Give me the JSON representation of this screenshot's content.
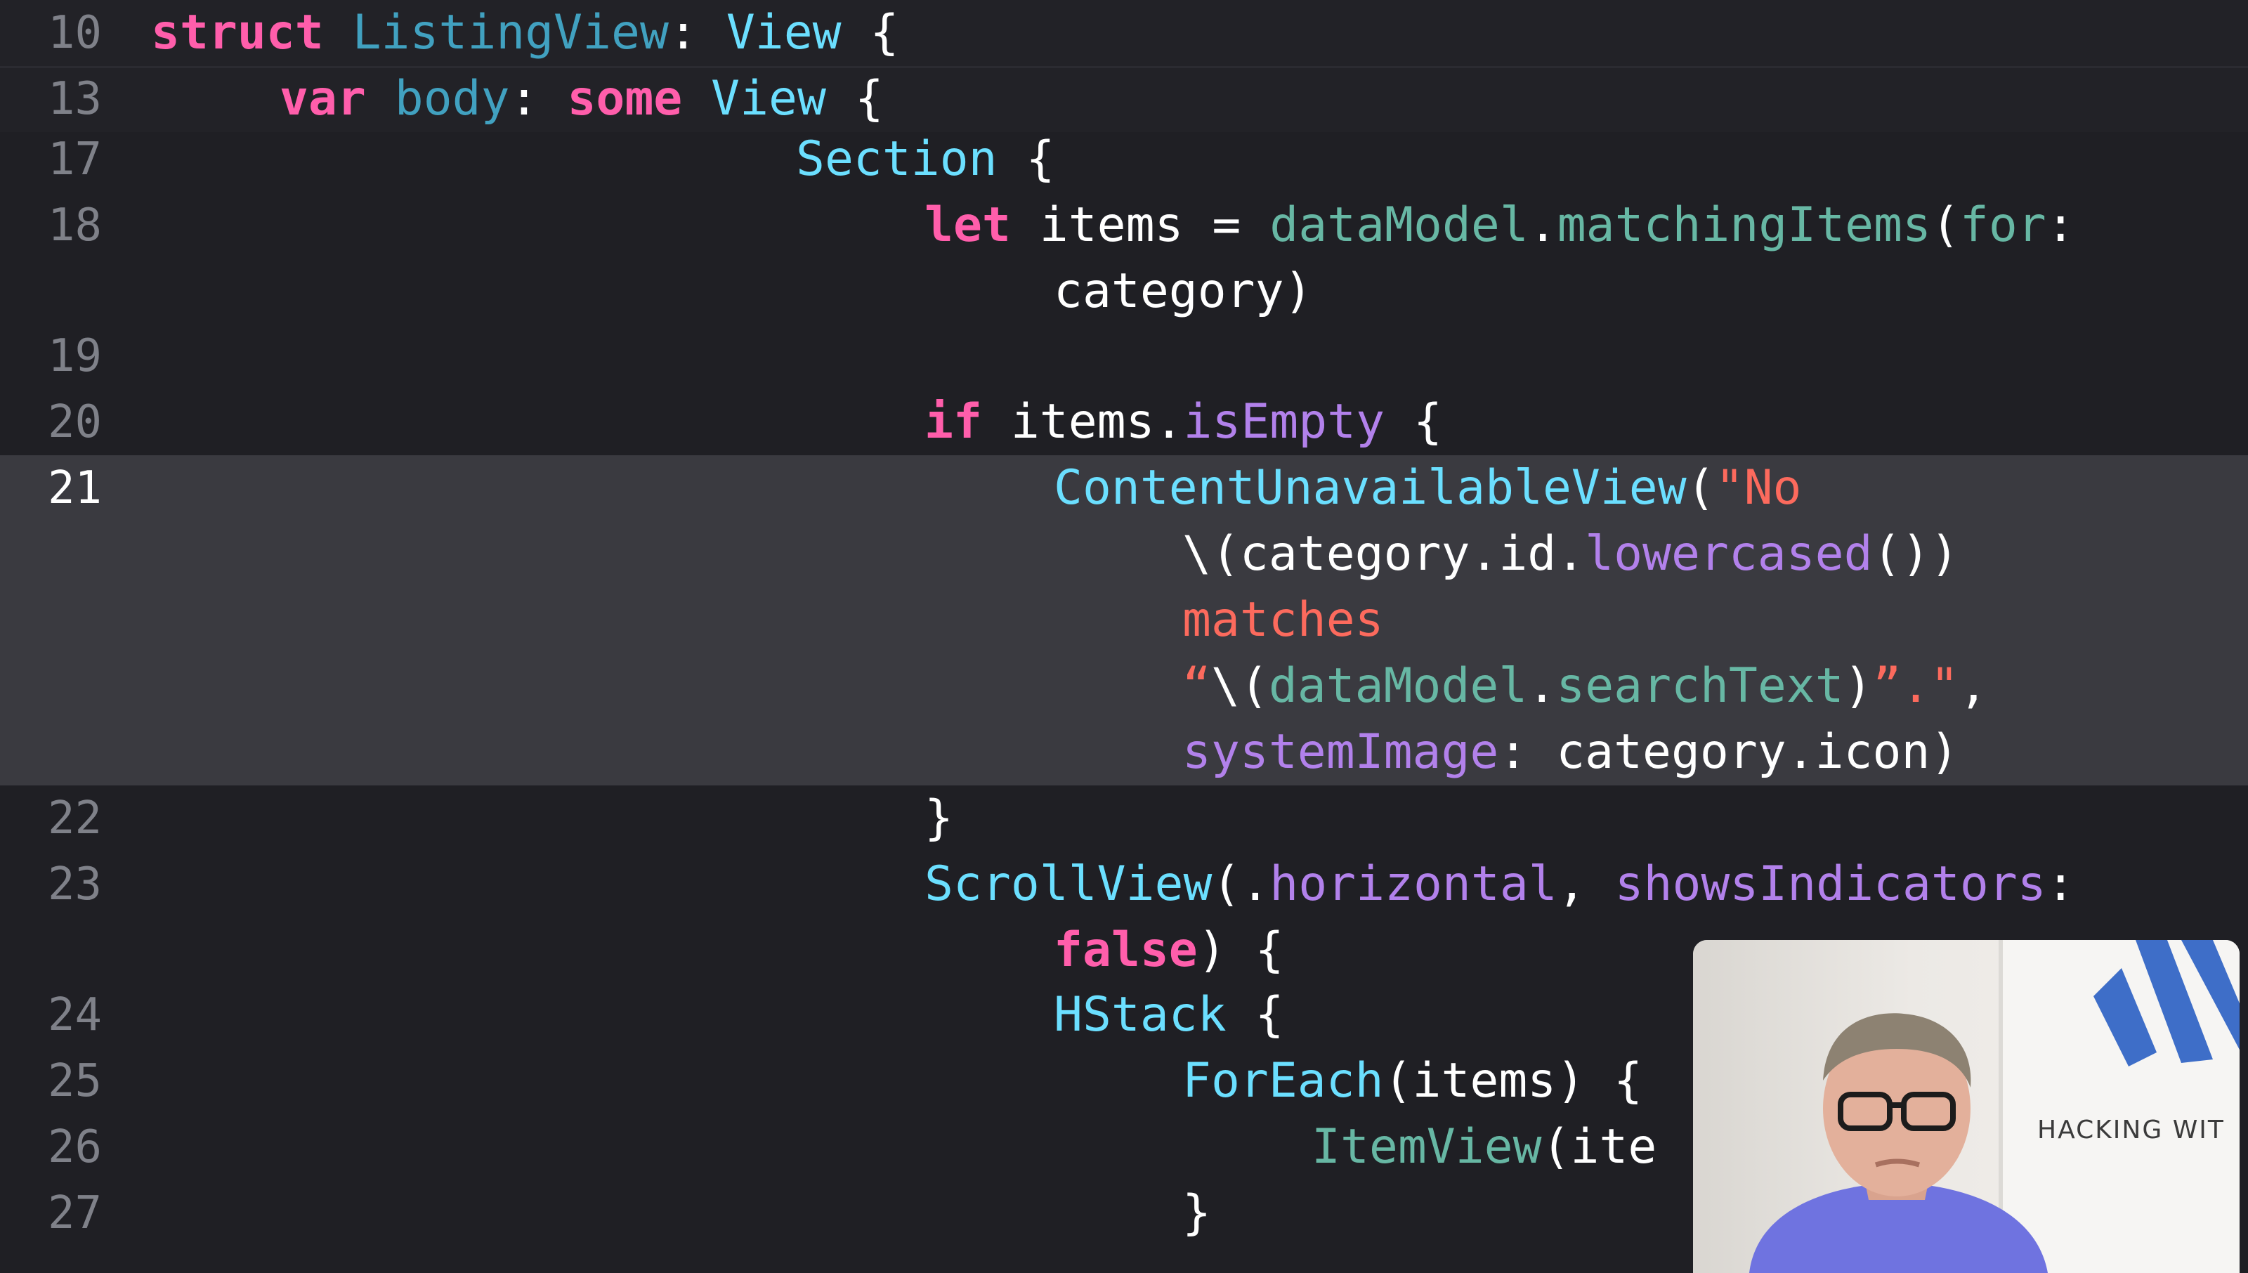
{
  "editor": {
    "lines": [
      {
        "num": "10",
        "tokens": [
          {
            "t": "struct",
            "c": "kw"
          },
          {
            "t": " ",
            "c": "plain"
          },
          {
            "t": "ListingView",
            "c": "decl"
          },
          {
            "t": ": ",
            "c": "plain"
          },
          {
            "t": "View",
            "c": "type"
          },
          {
            "t": " {",
            "c": "plain"
          }
        ]
      },
      {
        "num": "13",
        "tokens": [
          {
            "t": "var",
            "c": "kw"
          },
          {
            "t": " ",
            "c": "plain"
          },
          {
            "t": "body",
            "c": "decl"
          },
          {
            "t": ": ",
            "c": "plain"
          },
          {
            "t": "some",
            "c": "kw"
          },
          {
            "t": " ",
            "c": "plain"
          },
          {
            "t": "View",
            "c": "type"
          },
          {
            "t": " {",
            "c": "plain"
          }
        ]
      },
      {
        "num": "17",
        "tokens": [
          {
            "t": "Section",
            "c": "type"
          },
          {
            "t": " {",
            "c": "plain"
          }
        ]
      },
      {
        "num": "18",
        "tokens": [
          {
            "t": "let",
            "c": "kw"
          },
          {
            "t": " items = ",
            "c": "plain"
          },
          {
            "t": "dataModel",
            "c": "proj"
          },
          {
            "t": ".",
            "c": "plain"
          },
          {
            "t": "matchingItems",
            "c": "proj"
          },
          {
            "t": "(",
            "c": "plain"
          },
          {
            "t": "for",
            "c": "proj"
          },
          {
            "t": ":",
            "c": "plain"
          }
        ]
      },
      {
        "num": "",
        "tokens": [
          {
            "t": "category)",
            "c": "plain"
          }
        ]
      },
      {
        "num": "19",
        "tokens": []
      },
      {
        "num": "20",
        "tokens": [
          {
            "t": "if",
            "c": "kw"
          },
          {
            "t": " items.",
            "c": "plain"
          },
          {
            "t": "isEmpty",
            "c": "fn"
          },
          {
            "t": " {",
            "c": "plain"
          }
        ]
      },
      {
        "num": "21",
        "tokens": [
          {
            "t": "ContentUnavailableView",
            "c": "type"
          },
          {
            "t": "(",
            "c": "plain"
          },
          {
            "t": "\"No",
            "c": "str"
          }
        ]
      },
      {
        "num": "",
        "tokens": [
          {
            "t": "\\(category.id.",
            "c": "plain"
          },
          {
            "t": "lowercased",
            "c": "fn"
          },
          {
            "t": "())",
            "c": "plain"
          }
        ]
      },
      {
        "num": "",
        "tokens": [
          {
            "t": "matches",
            "c": "str"
          }
        ]
      },
      {
        "num": "",
        "tokens": [
          {
            "t": "“",
            "c": "str"
          },
          {
            "t": "\\(",
            "c": "plain"
          },
          {
            "t": "dataModel",
            "c": "proj"
          },
          {
            "t": ".",
            "c": "plain"
          },
          {
            "t": "searchText",
            "c": "proj"
          },
          {
            "t": ")",
            "c": "plain"
          },
          {
            "t": "”.\"",
            "c": "str"
          },
          {
            "t": ",",
            "c": "plain"
          }
        ]
      },
      {
        "num": "",
        "tokens": [
          {
            "t": "systemImage",
            "c": "fn"
          },
          {
            "t": ": category.icon)",
            "c": "plain"
          }
        ]
      },
      {
        "num": "22",
        "tokens": [
          {
            "t": "}",
            "c": "plain"
          }
        ]
      },
      {
        "num": "23",
        "tokens": [
          {
            "t": "ScrollView",
            "c": "type"
          },
          {
            "t": "(.",
            "c": "plain"
          },
          {
            "t": "horizontal",
            "c": "fn"
          },
          {
            "t": ", ",
            "c": "plain"
          },
          {
            "t": "showsIndicators",
            "c": "fn"
          },
          {
            "t": ":",
            "c": "plain"
          }
        ]
      },
      {
        "num": "",
        "tokens": [
          {
            "t": "false",
            "c": "kw"
          },
          {
            "t": ") {",
            "c": "plain"
          }
        ]
      },
      {
        "num": "24",
        "tokens": [
          {
            "t": "HStack",
            "c": "type"
          },
          {
            "t": " {",
            "c": "plain"
          }
        ]
      },
      {
        "num": "25",
        "tokens": [
          {
            "t": "ForEach",
            "c": "type"
          },
          {
            "t": "(items) {",
            "c": "plain"
          }
        ]
      },
      {
        "num": "26",
        "tokens": [
          {
            "t": "ItemView",
            "c": "proj"
          },
          {
            "t": "(ite",
            "c": "plain"
          }
        ]
      },
      {
        "num": "27",
        "tokens": [
          {
            "t": "}",
            "c": "plain"
          }
        ]
      }
    ],
    "active_line": "21"
  },
  "webcam": {
    "brand_text": "HACKING WIT"
  },
  "colors": {
    "background": "#1f1f24",
    "keyword": "#ff5eab",
    "type": "#6bdfff",
    "declaration": "#41a1c0",
    "function": "#b281eb",
    "project": "#67b7a4",
    "string": "#fc6a5d",
    "line_highlight": "#3a3a40"
  }
}
